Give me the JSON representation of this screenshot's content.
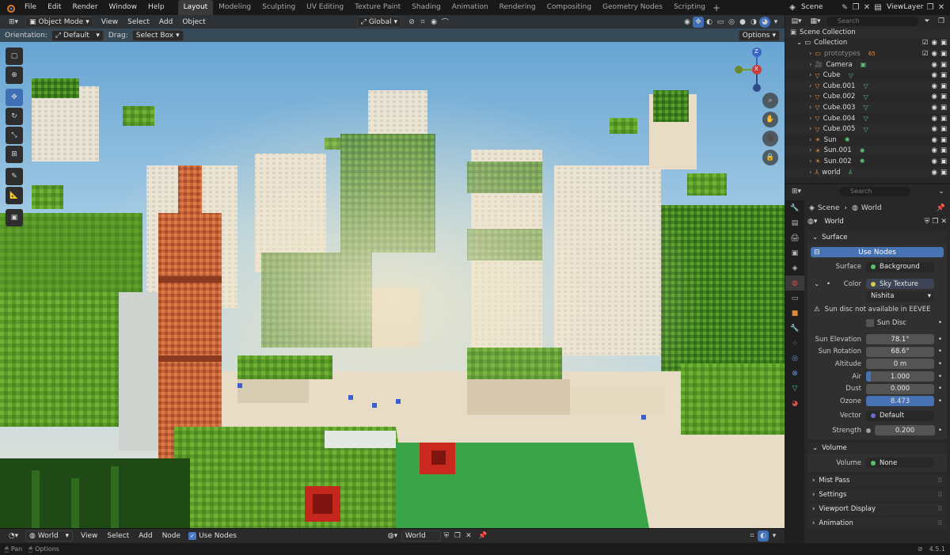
{
  "top_menu": [
    "File",
    "Edit",
    "Render",
    "Window",
    "Help"
  ],
  "workspaces": [
    "Layout",
    "Modeling",
    "Sculpting",
    "UV Editing",
    "Texture Paint",
    "Shading",
    "Animation",
    "Rendering",
    "Compositing",
    "Geometry Nodes",
    "Scripting"
  ],
  "active_workspace": "Layout",
  "scene": {
    "label": "Scene",
    "view_layer": "ViewLayer"
  },
  "viewport": {
    "mode": "Object Mode",
    "menus": [
      "View",
      "Select",
      "Add",
      "Object"
    ],
    "transform_orientation": "Global",
    "orientation_label": "Orientation:",
    "orientation_value": "Default",
    "drag_label": "Drag:",
    "drag_value": "Select Box",
    "options_label": "Options",
    "gizmo": {
      "z": "Z",
      "x": "X",
      "y": "Y"
    }
  },
  "outliner": {
    "search_placeholder": "Search",
    "root": "Scene Collection",
    "collection": "Collection",
    "items": [
      {
        "name": "prototypes",
        "icon": "collection-icon",
        "dim": true
      },
      {
        "name": "Camera",
        "icon": "camera-icon"
      },
      {
        "name": "Cube",
        "icon": "mesh-icon"
      },
      {
        "name": "Cube.001",
        "icon": "mesh-icon"
      },
      {
        "name": "Cube.002",
        "icon": "mesh-icon"
      },
      {
        "name": "Cube.003",
        "icon": "mesh-icon"
      },
      {
        "name": "Cube.004",
        "icon": "mesh-icon"
      },
      {
        "name": "Cube.005",
        "icon": "mesh-icon"
      },
      {
        "name": "Sun",
        "icon": "light-icon"
      },
      {
        "name": "Sun.001",
        "icon": "light-icon"
      },
      {
        "name": "Sun.002",
        "icon": "light-icon"
      },
      {
        "name": "world",
        "icon": "empty-icon"
      }
    ],
    "prototypes_badge": "65"
  },
  "properties": {
    "search_placeholder": "Search",
    "breadcrumb_scene": "Scene",
    "breadcrumb_world": "World",
    "world_name": "World",
    "surface_section": "Surface",
    "use_nodes": "Use Nodes",
    "surface_label": "Surface",
    "surface_value": "Background",
    "color_label": "Color",
    "color_value": "Sky Texture",
    "sky_type": "Nishita",
    "warning": "Sun disc not available in EEVEE",
    "sun_disc": "Sun Disc",
    "fields": [
      {
        "label": "Sun Elevation",
        "value": "78.1°"
      },
      {
        "label": "Sun Rotation",
        "value": "68.6°"
      },
      {
        "label": "Altitude",
        "value": "0 m"
      },
      {
        "label": "Air",
        "value": "1.000"
      },
      {
        "label": "Dust",
        "value": "0.000"
      },
      {
        "label": "Ozone",
        "value": "8.473"
      }
    ],
    "vector_label": "Vector",
    "vector_value": "Default",
    "strength_label": "Strength",
    "strength_value": "0.200",
    "volume_section": "Volume",
    "volume_label": "Volume",
    "volume_value": "None",
    "collapsed_sections": [
      "Mist Pass",
      "Settings",
      "Viewport Display",
      "Animation"
    ]
  },
  "bottom_header": {
    "world": "World",
    "menus": [
      "View",
      "Select",
      "Add",
      "Node"
    ],
    "use_nodes": "Use Nodes",
    "world_field": "World"
  },
  "status": {
    "pan": "Pan",
    "options": "Options",
    "version": "4.5.1"
  }
}
